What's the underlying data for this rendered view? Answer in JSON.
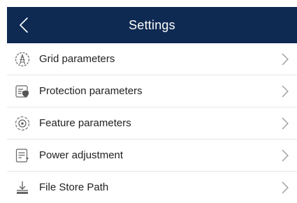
{
  "header": {
    "title": "Settings",
    "back_icon": "chevron-left-icon",
    "background": "#0e2a52"
  },
  "items": [
    {
      "label": "Grid parameters",
      "icon": "grid-tower-icon"
    },
    {
      "label": "Protection parameters",
      "icon": "protection-icon"
    },
    {
      "label": "Feature parameters",
      "icon": "feature-icon"
    },
    {
      "label": "Power adjustment",
      "icon": "power-adjust-icon"
    },
    {
      "label": "File Store Path",
      "icon": "download-icon"
    }
  ],
  "chevron_icon": "chevron-right-icon"
}
